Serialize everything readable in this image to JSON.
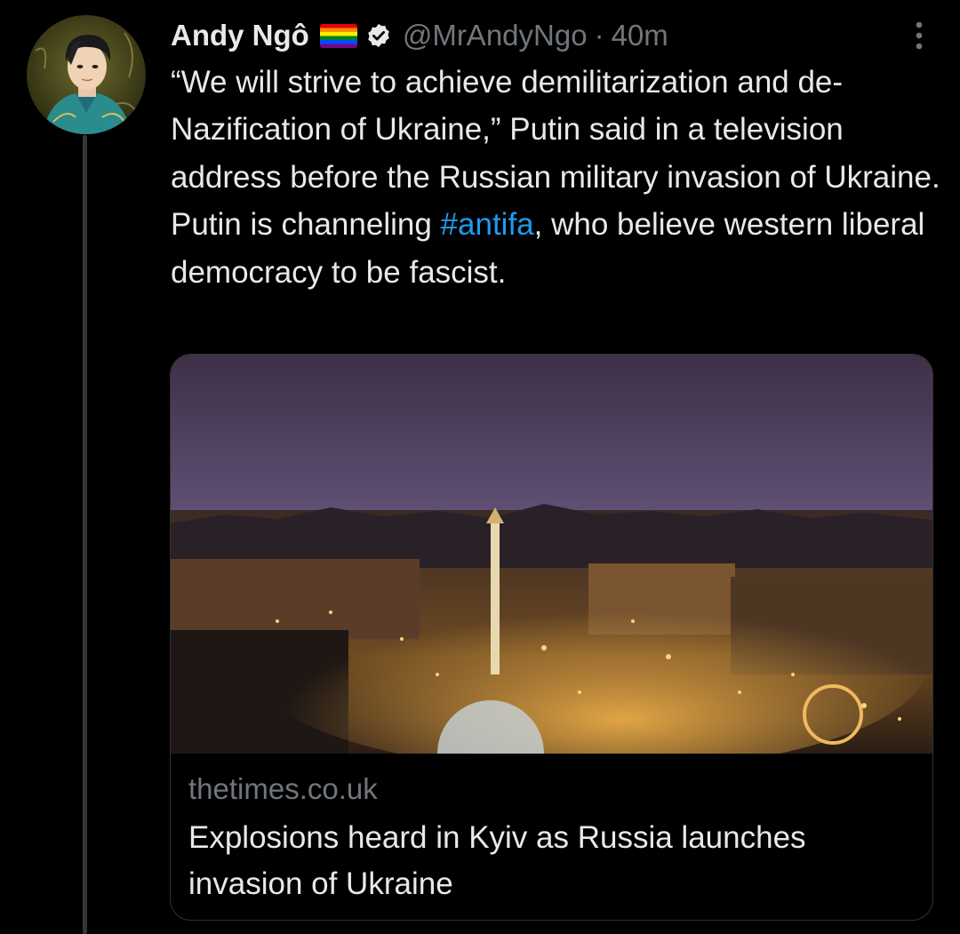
{
  "tweet": {
    "author_name": "Andy Ngô",
    "handle": "@MrAndyNgo",
    "separator": "·",
    "time": "40m",
    "text_before_hashtag": "“We will strive to achieve demilitarization and de-Nazification of Ukraine,” Putin said in a television address before the Russian military invasion of Ukraine. Putin is channeling ",
    "hashtag": "#antifa",
    "text_after_hashtag": ", who believe western liberal democracy to be fascist."
  },
  "card": {
    "domain": "thetimes.co.uk",
    "title": "Explosions heard in Kyiv as Russia launches invasion of Ukraine"
  },
  "icons": {
    "flag": "rainbow-flag-icon",
    "verified": "verified-badge-icon",
    "more": "more-options-icon"
  },
  "colors": {
    "background": "#000000",
    "text": "#e7e9ea",
    "secondary": "#71767b",
    "link": "#1d9bf0",
    "border": "#2f3336"
  }
}
